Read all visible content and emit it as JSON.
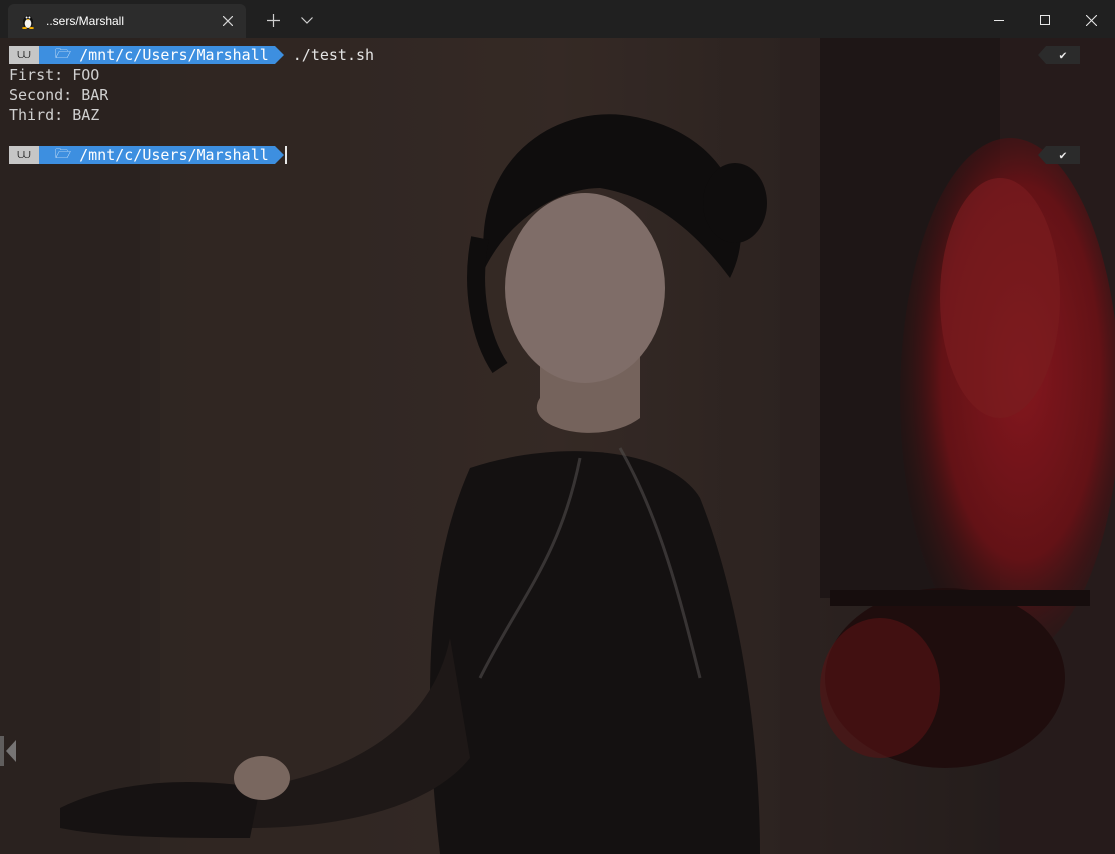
{
  "window": {
    "tab_title": "..sers/Marshall",
    "tab_icon": "linux-tux-icon"
  },
  "terminal": {
    "prompt1": {
      "os_icon": "⩊",
      "folder_icon": "🗁",
      "path": "/mnt/c/Users/Marshall",
      "command": "./test.sh",
      "status": "✔"
    },
    "output": [
      "First: FOO",
      "Second: BAR",
      "Third: BAZ"
    ],
    "prompt2": {
      "os_icon": "⩊",
      "folder_icon": "🗁",
      "path": "/mnt/c/Users/Marshall",
      "status": "✔"
    }
  },
  "colors": {
    "path_segment": "#3d8fe0",
    "os_segment": "#c6c6c6",
    "titlebar": "#202020"
  }
}
